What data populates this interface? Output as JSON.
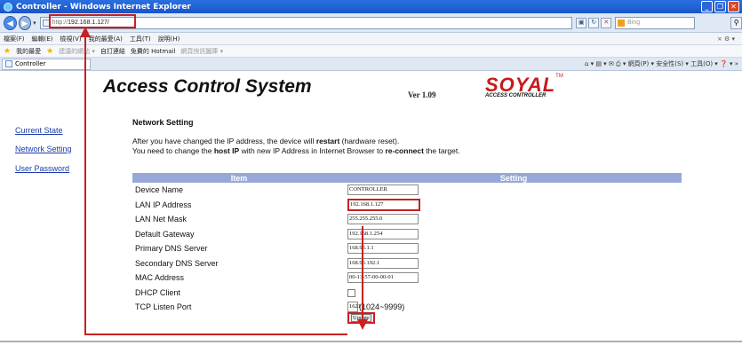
{
  "window": {
    "title": "Controller - Windows Internet Explorer"
  },
  "address": {
    "url_prefix": "http://",
    "url_host": "192.168.1.127/",
    "search_placeholder": "Bing"
  },
  "menubar": {
    "items": [
      "檔案(F)",
      "編輯(E)",
      "檢視(V)",
      "我的最愛(A)",
      "工具(T)",
      "說明(H)"
    ],
    "right": "×  ⚙ ▾"
  },
  "favorites": {
    "label": "我的最愛",
    "items": [
      "建議的網站 ▾",
      "自訂連結",
      "免費的 Hotmail",
      "網頁快訊圖庫 ▾"
    ]
  },
  "tab": {
    "title": "Controller"
  },
  "commandbar": {
    "text": "⌂ ▾  ▤ ▾  ✉  ⎙ ▾  網頁(P) ▾  安全性(S) ▾  工具(O) ▾  ❓ ▾  »"
  },
  "header": {
    "title": "Access Control System",
    "version": "Ver 1.09",
    "brand": "SOYAL",
    "brand_sub": "ACCESS CONTROLLER",
    "brand_tm": "TM"
  },
  "sidebar": {
    "items": [
      "Current State",
      "Network Setting",
      "User Password"
    ]
  },
  "network": {
    "section_title": "Network Setting",
    "note1_pre": "After you have changed the IP address, the device will ",
    "note1_bold": "restart",
    "note1_post": " (hardware reset).",
    "note2_pre": "You need to change the ",
    "note2_bold1": "host IP",
    "note2_mid": " with new IP Address in Internet Browser to ",
    "note2_bold2": "re-connect",
    "note2_post": " the target.",
    "col_item": "Item",
    "col_setting": "Setting",
    "rows": [
      {
        "label": "Device Name",
        "value": "CONTROLLER"
      },
      {
        "label": "LAN IP Address",
        "value": "192.168.1.127"
      },
      {
        "label": "LAN Net Mask",
        "value": "255.255.255.0"
      },
      {
        "label": "Default Gateway",
        "value": "192.168.1.254"
      },
      {
        "label": "Primary DNS Server",
        "value": "168.95.1.1"
      },
      {
        "label": "Secondary DNS Server",
        "value": "168.95.192.1"
      },
      {
        "label": "MAC Address",
        "value": "00-13-57-00-00-01"
      },
      {
        "label": "DHCP Client",
        "value": ""
      },
      {
        "label": "TCP Listen Port",
        "value": "1621"
      }
    ],
    "port_range": "(1024~9999)",
    "update_label": "Update"
  },
  "colors": {
    "table_header": "#97a8d8",
    "highlight": "#c82020",
    "brand": "#c81a1a",
    "link": "#1a3caa"
  }
}
